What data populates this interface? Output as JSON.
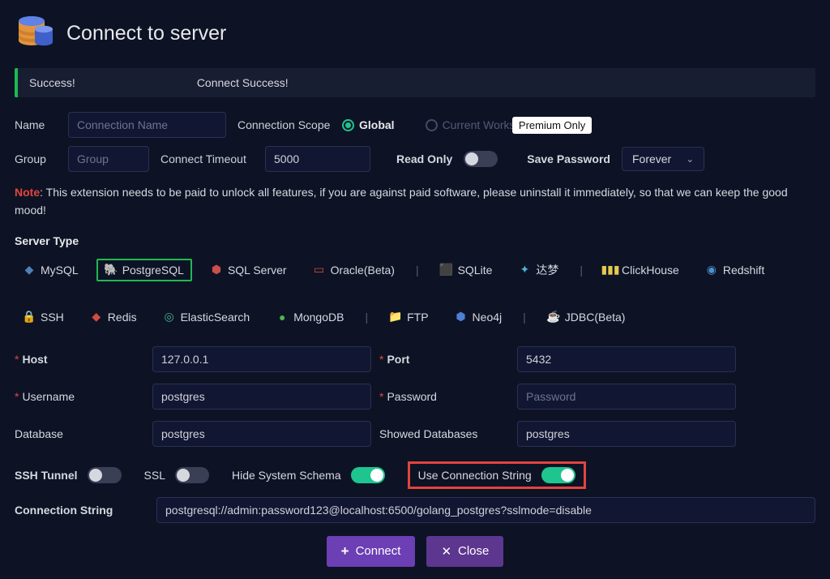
{
  "header": {
    "title": "Connect to server"
  },
  "alert": {
    "status": "Success!",
    "message": "Connect Success!"
  },
  "fields": {
    "name_label": "Name",
    "name_placeholder": "Connection Name",
    "scope_label": "Connection Scope",
    "scope_global": "Global",
    "scope_workspace": "Current Workspace",
    "premium_badge": "Premium Only",
    "group_label": "Group",
    "group_placeholder": "Group",
    "timeout_label": "Connect Timeout",
    "timeout_value": "5000",
    "readonly_label": "Read Only",
    "savepw_label": "Save Password",
    "savepw_value": "Forever"
  },
  "note_prefix": "Note",
  "note_body": ": This extension needs to be paid to unlock all features, if you are against paid software, please uninstall it immediately, so that we can keep the good mood!",
  "server_type_label": "Server Type",
  "types": {
    "mysql": "MySQL",
    "postgresql": "PostgreSQL",
    "sqlserver": "SQL Server",
    "oracle": "Oracle(Beta)",
    "sqlite": "SQLite",
    "dm": "达梦",
    "clickhouse": "ClickHouse",
    "redshift": "Redshift",
    "ssh": "SSH",
    "redis": "Redis",
    "es": "ElasticSearch",
    "mongodb": "MongoDB",
    "ftp": "FTP",
    "neo4j": "Neo4j",
    "jdbc": "JDBC(Beta)"
  },
  "conn": {
    "host_label": "Host",
    "host_value": "127.0.0.1",
    "port_label": "Port",
    "port_value": "5432",
    "user_label": "Username",
    "user_value": "postgres",
    "pass_label": "Password",
    "pass_placeholder": "Password",
    "db_label": "Database",
    "db_value": "postgres",
    "showdb_label": "Showed Databases",
    "showdb_value": "postgres"
  },
  "toggles": {
    "ssh_label": "SSH Tunnel",
    "ssl_label": "SSL",
    "hide_label": "Hide System Schema",
    "ucs_label": "Use Connection String"
  },
  "cs_label": "Connection String",
  "cs_value": "postgresql://admin:password123@localhost:6500/golang_postgres?sslmode=disable",
  "buttons": {
    "connect": "Connect",
    "close": "Close"
  },
  "divider": "|"
}
